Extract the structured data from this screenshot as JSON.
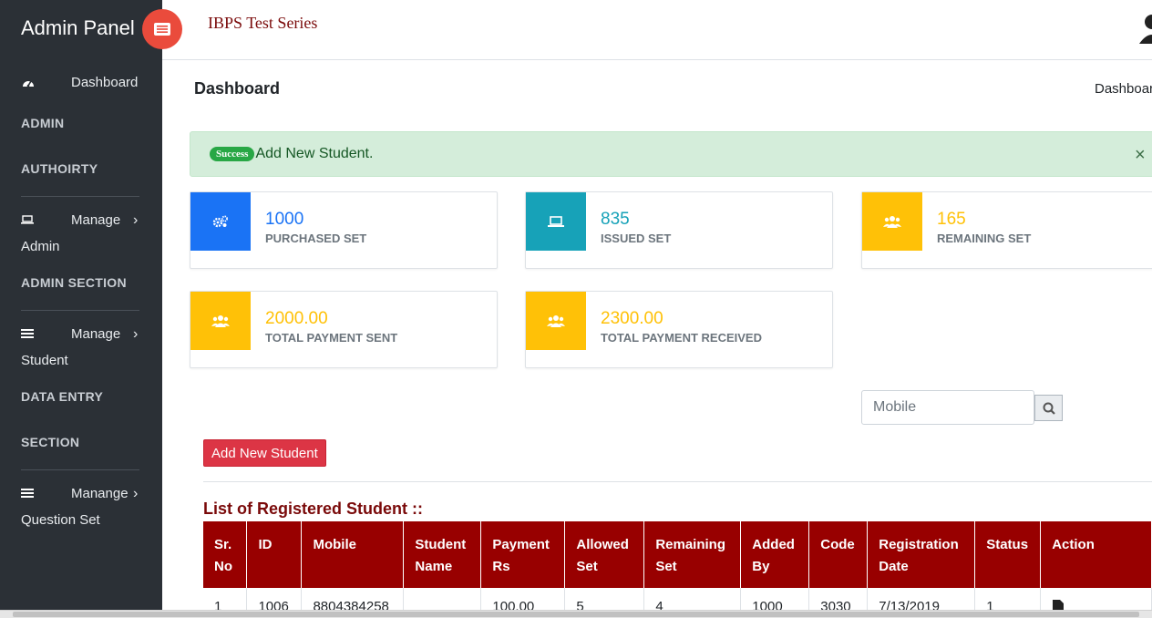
{
  "sidebar": {
    "brand": "Admin Panel",
    "dashboard": "Dashboard",
    "sections": [
      {
        "head1": "ADMIN",
        "head2": "AUTHOIRTY",
        "manage1": "Manage",
        "manage2": "Admin"
      },
      {
        "head1": "ADMIN SECTION",
        "manage1": "Manage",
        "manage2": "Student"
      },
      {
        "head1": "DATA ENTRY",
        "head2": "SECTION",
        "manage1": "Manange",
        "manage2": "Question Set"
      }
    ],
    "chevron": "›"
  },
  "header": {
    "app_title": "IBPS Test Series"
  },
  "page": {
    "title": "Dashboard",
    "breadcrumb": "Dashboard"
  },
  "alert": {
    "badge": "Success",
    "message": "Add New Student.",
    "close": "×"
  },
  "cards": [
    {
      "value": "1000",
      "label": "PURCHASED SET",
      "icon": "cogs-icon",
      "color": "#1a73f5",
      "text_color": "#1a73f5"
    },
    {
      "value": "835",
      "label": "ISSUED SET",
      "icon": "laptop-icon",
      "color": "#17a2b8",
      "text_color": "#17a2b8"
    },
    {
      "value": "165",
      "label": "REMAINING SET",
      "icon": "users-icon",
      "color": "#ffc107",
      "text_color": "#ffc107"
    },
    {
      "value": "2000.00",
      "label": "TOTAL PAYMENT SENT",
      "icon": "users-icon",
      "color": "#ffc107",
      "text_color": "#ffc107"
    },
    {
      "value": "2300.00",
      "label": "TOTAL PAYMENT RECEIVED",
      "icon": "users-icon",
      "color": "#ffc107",
      "text_color": "#ffc107"
    }
  ],
  "search": {
    "placeholder": "Mobile"
  },
  "add_button": "Add New Student",
  "list_title": "List of Registered Student ::",
  "table": {
    "headers": [
      "Sr. No",
      "ID",
      "Mobile",
      "Student Name",
      "Payment Rs",
      "Allowed Set",
      "Remaining Set",
      "Added By",
      "Code",
      "Registration Date",
      "Status",
      "Action"
    ],
    "rows": [
      [
        "1",
        "1006",
        "8804384258",
        "",
        "100.00",
        "5",
        "4",
        "1000",
        "3030",
        "7/13/2019",
        "1",
        ""
      ]
    ]
  },
  "colors": {
    "sidebar": "#2b3036",
    "header_row": "#980000",
    "accent_red": "#dc3545",
    "title_red": "#7a0a0a"
  }
}
